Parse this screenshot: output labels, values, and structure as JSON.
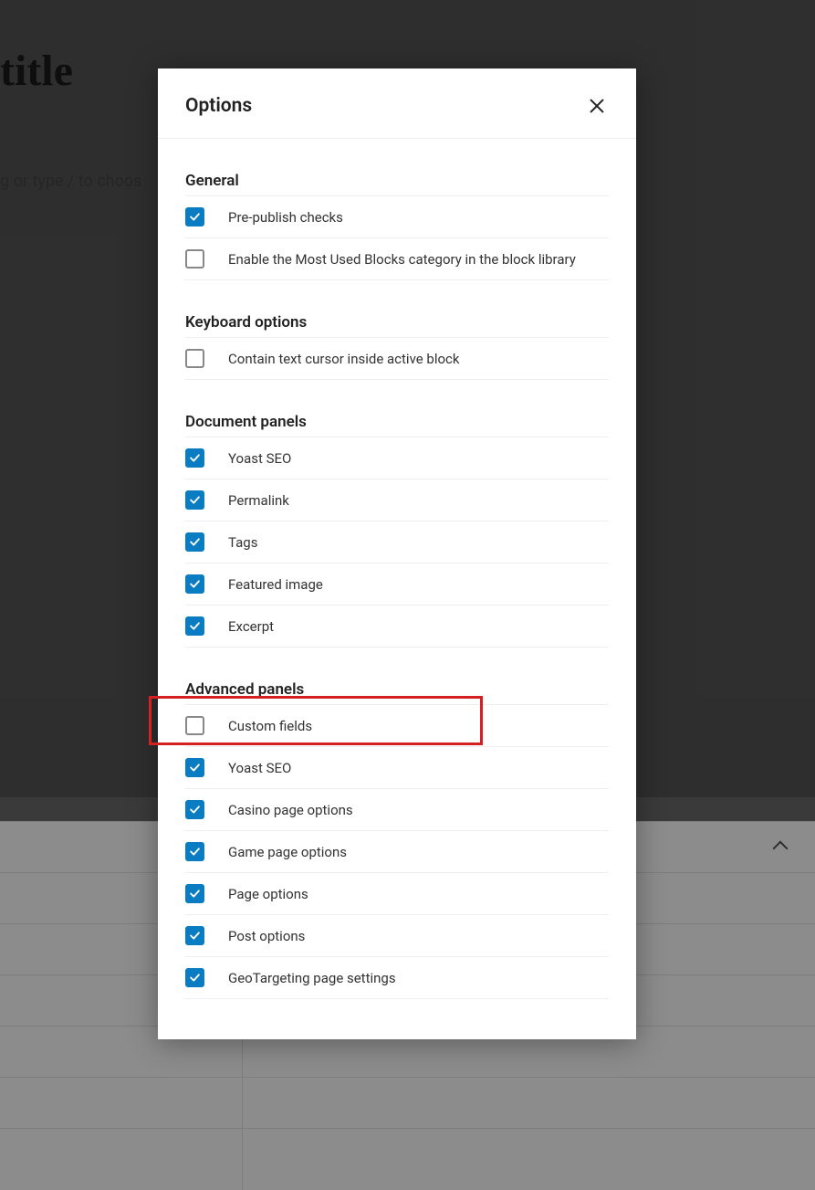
{
  "background": {
    "title_fragment": "title",
    "placeholder_fragment": "g or type / to choos"
  },
  "modal": {
    "title": "Options",
    "sections": {
      "general": {
        "heading": "General",
        "items": [
          {
            "label": "Pre-publish checks",
            "checked": true
          },
          {
            "label": "Enable the Most Used Blocks category in the block library",
            "checked": false
          }
        ]
      },
      "keyboard": {
        "heading": "Keyboard options",
        "items": [
          {
            "label": "Contain text cursor inside active block",
            "checked": false
          }
        ]
      },
      "document_panels": {
        "heading": "Document panels",
        "items": [
          {
            "label": "Yoast SEO",
            "checked": true
          },
          {
            "label": "Permalink",
            "checked": true
          },
          {
            "label": "Tags",
            "checked": true
          },
          {
            "label": "Featured image",
            "checked": true
          },
          {
            "label": "Excerpt",
            "checked": true
          }
        ]
      },
      "advanced_panels": {
        "heading": "Advanced panels",
        "items": [
          {
            "label": "Custom fields",
            "checked": false,
            "highlighted": true
          },
          {
            "label": "Yoast SEO",
            "checked": true
          },
          {
            "label": "Casino page options",
            "checked": true
          },
          {
            "label": "Game page options",
            "checked": true
          },
          {
            "label": "Page options",
            "checked": true
          },
          {
            "label": "Post options",
            "checked": true
          },
          {
            "label": "GeoTargeting page settings",
            "checked": true
          }
        ]
      }
    }
  }
}
